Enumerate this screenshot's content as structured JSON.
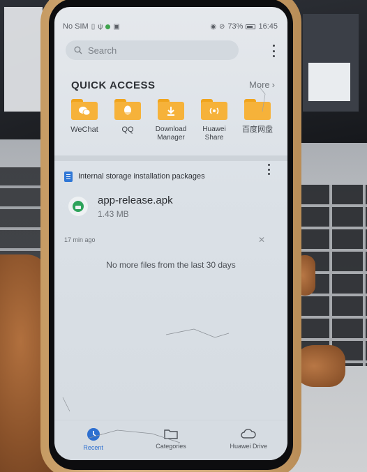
{
  "status_bar": {
    "carrier": "No SIM",
    "battery": "73%",
    "time": "16:45"
  },
  "search": {
    "placeholder": "Search"
  },
  "quick_access": {
    "title": "QUICK ACCESS",
    "more_label": "More",
    "items": [
      {
        "label": "WeChat",
        "icon": "wechat-icon"
      },
      {
        "label": "QQ",
        "icon": "qq-icon"
      },
      {
        "label": "Download Manager",
        "icon": "download-icon"
      },
      {
        "label": "Huawei Share",
        "icon": "share-icon"
      },
      {
        "label": "百度网盘",
        "icon": "folder-icon"
      }
    ]
  },
  "recent": {
    "section_title": "Internal storage installation packages",
    "file": {
      "name": "app-release.apk",
      "size": "1.43 MB"
    },
    "timestamp": "17 min ago",
    "empty_message": "No more files from the last 30 days"
  },
  "bottom_nav": {
    "items": [
      {
        "label": "Recent",
        "active": true
      },
      {
        "label": "Categories",
        "active": false
      },
      {
        "label": "Huawei Drive",
        "active": false
      }
    ]
  },
  "colors": {
    "folder": "#f6b23a",
    "accent": "#2d6fd0",
    "apk_green": "#2da35a",
    "doc_blue": "#2f77d6"
  }
}
